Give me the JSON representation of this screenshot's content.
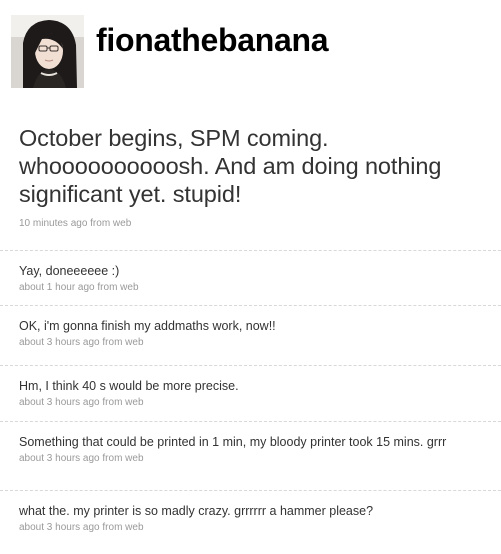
{
  "profile": {
    "screen_name": "fionathebanana"
  },
  "featured": {
    "text": "October begins, SPM coming. whoooooooooosh. And am doing nothing significant yet. stupid!",
    "meta": "10 minutes ago from web"
  },
  "timeline": [
    {
      "text": "Yay, doneeeeee :)",
      "meta": "about 1 hour ago from web"
    },
    {
      "text": "OK, i'm gonna finish my addmaths work, now!!",
      "meta": "about 3 hours ago from web"
    },
    {
      "text": "Hm, I think 40 s would be more precise.",
      "meta": "about 3 hours ago from web"
    },
    {
      "text": "Something that could be printed in 1 min, my bloody printer took 15 mins. grrr",
      "meta": "about 3 hours ago from web"
    },
    {
      "text": "what the. my printer is so madly crazy. grrrrrr a hammer please?",
      "meta": "about 3 hours ago from web"
    }
  ],
  "colors": {
    "screen_name": "#000000",
    "status_text": "#333333",
    "meta_text": "#999999",
    "divider": "#d8d8d8"
  }
}
